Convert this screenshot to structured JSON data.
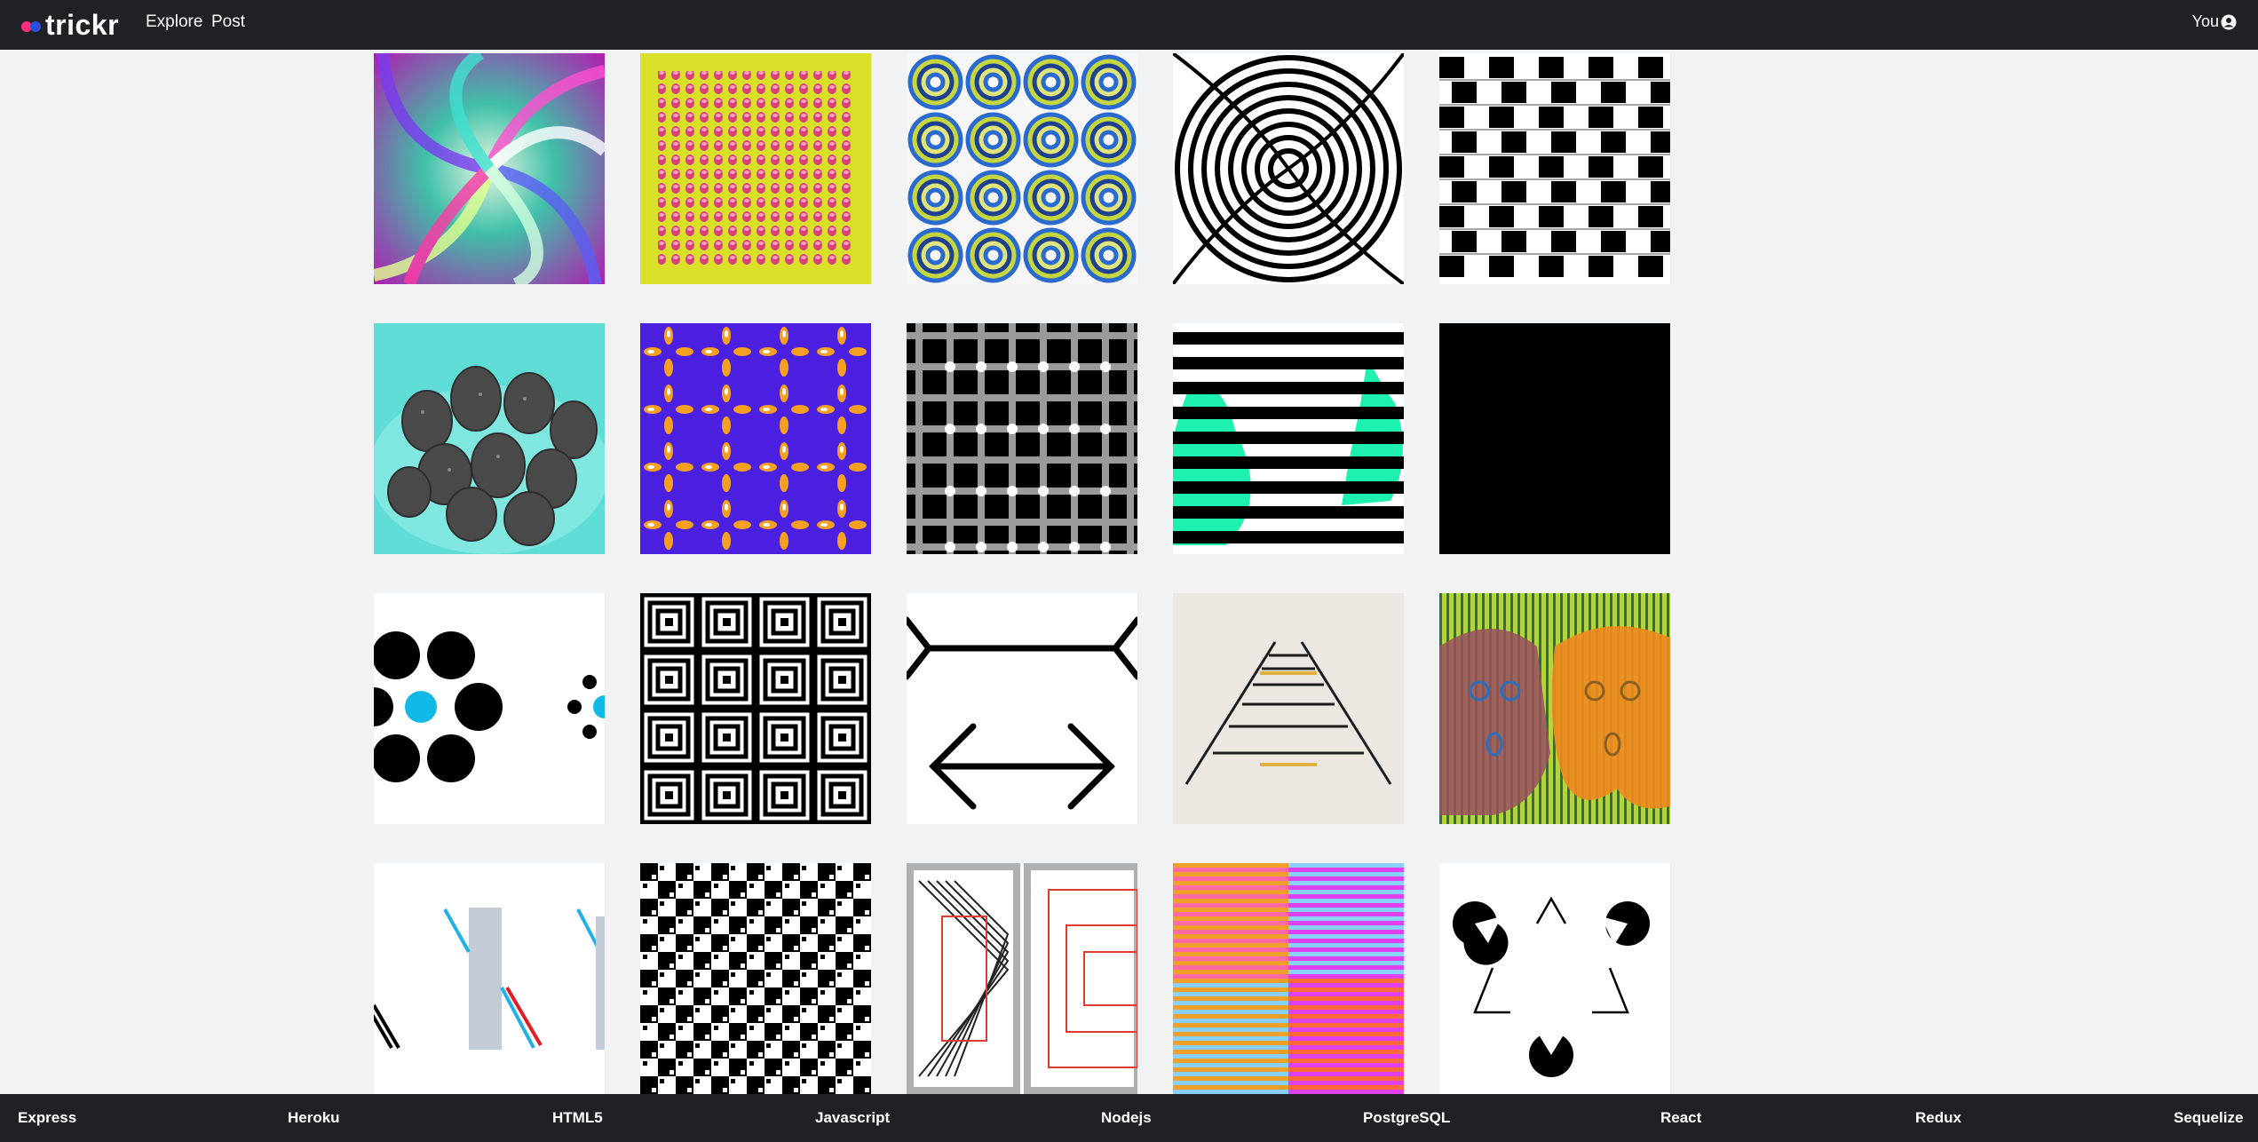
{
  "header": {
    "logo_text": "trickr",
    "nav": {
      "explore": "Explore",
      "post": "Post"
    },
    "user_label": "You"
  },
  "gallery": {
    "images": [
      "rainbow-swirl-illusion",
      "pink-dots-on-yellow-illusion",
      "rotating-snakes-illusion",
      "black-white-spiral-illusion",
      "cafe-wall-illusion",
      "grey-strawberries-illusion",
      "orange-petals-on-blue-illusion",
      "scintillating-grid-illusion",
      "striped-pears-illusion",
      "black-square",
      "ebbinghaus-circles-illusion",
      "concentric-squares-illusion",
      "muller-lyer-arrows-illusion",
      "ponzo-railway-illusion",
      "striped-scream-faces-illusion",
      "poggendorff-illusion",
      "checkerboard-bulge-illusion",
      "concentric-lines-illusion",
      "munker-stripes-illusion",
      "kanizsa-triangle-illusion"
    ]
  },
  "footer": {
    "links": [
      "Express",
      "Heroku",
      "HTML5",
      "Javascript",
      "Nodejs",
      "PostgreSQL",
      "React",
      "Redux",
      "Sequelize"
    ]
  },
  "colors": {
    "bar": "#202124",
    "background": "#f1f2f4"
  }
}
